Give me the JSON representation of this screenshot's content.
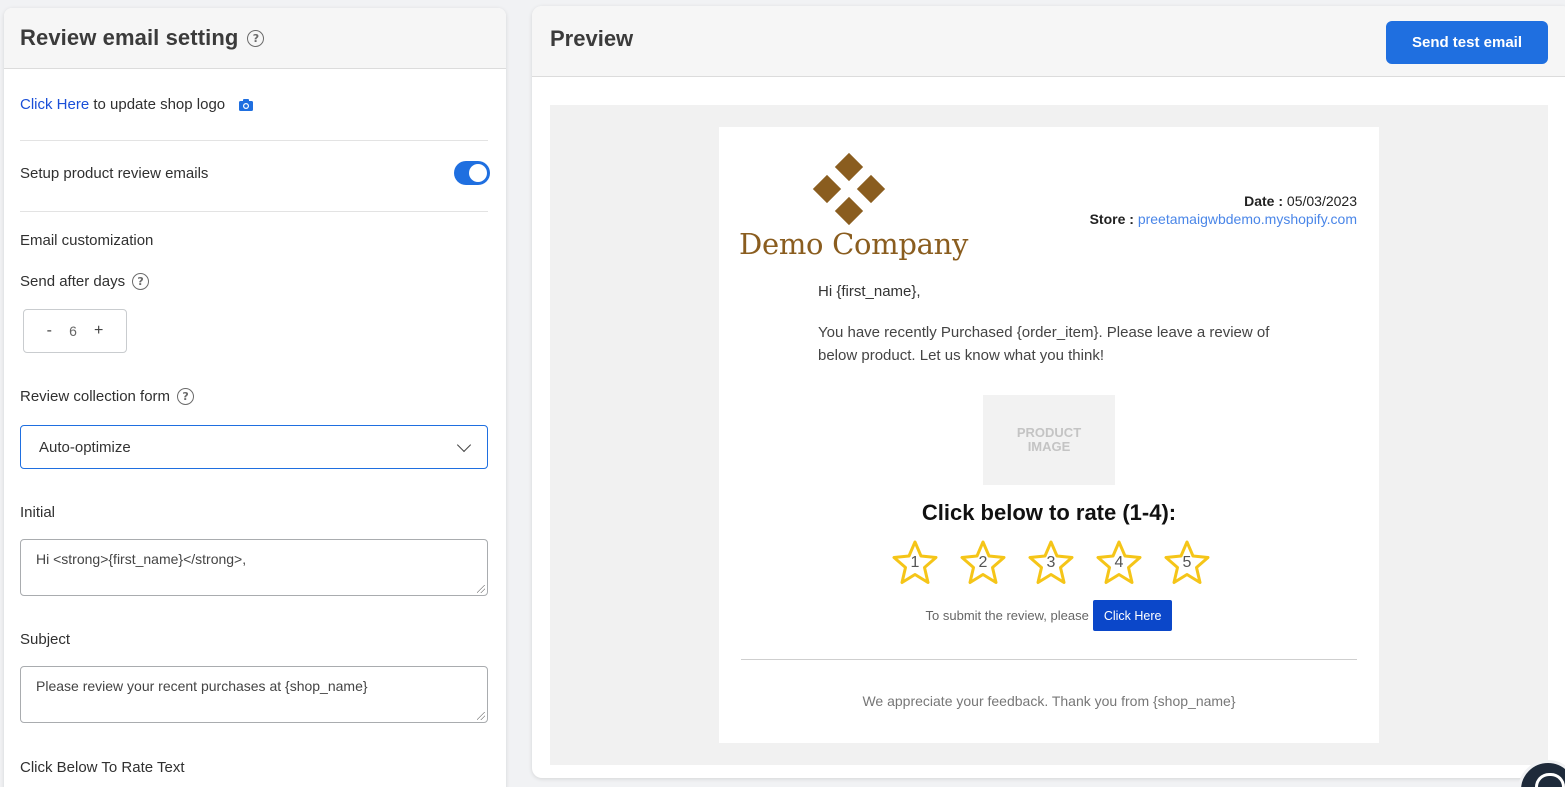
{
  "settings": {
    "title": "Review email setting",
    "logo_link": "Click Here",
    "logo_text": " to update shop logo",
    "setup_label": "Setup product review emails",
    "setup_enabled": true,
    "email_customization": "Email customization",
    "send_after_days_label": "Send after days",
    "send_after_days_value": "6",
    "stepper_minus": "-",
    "stepper_plus": "+",
    "review_form_label": "Review collection form",
    "review_form_value": "Auto-optimize",
    "initial_label": "Initial",
    "initial_value": "Hi <strong>{first_name}</strong>,",
    "subject_label": "Subject",
    "subject_value": "Please review your recent purchases at {shop_name}",
    "rate_text_label": "Click Below To Rate Text"
  },
  "preview": {
    "title": "Preview",
    "send_test_label": "Send test email",
    "email": {
      "company_name": "Demo Company",
      "date_label": "Date :",
      "date_value": " 05/03/2023",
      "store_label": "Store :",
      "store_value": " preetamaigwbdemo.myshopify.com",
      "greeting_prefix": "Hi ",
      "greeting_name": "{first_name}",
      "greeting_suffix": ",",
      "body": "You have recently Purchased {order_item}. Please leave a review of below product. Let us know what you think!",
      "product_image_line1": "PRODUCT",
      "product_image_line2": "IMAGE",
      "rate_heading": "Click below to rate (1-4):",
      "stars": [
        "1",
        "2",
        "3",
        "4",
        "5"
      ],
      "submit_text": "To submit the review, please",
      "submit_button": "Click Here",
      "footer": "We appreciate your feedback. Thank you from {shop_name}"
    }
  },
  "colors": {
    "primary": "#1f6fe0",
    "brand": "#8a5d1f",
    "star": "#f5c518",
    "submit": "#0b47c9"
  },
  "icons": {
    "help": "question-circle-icon",
    "camera": "camera-icon",
    "chevron": "chevron-down-icon",
    "star": "star-icon"
  }
}
